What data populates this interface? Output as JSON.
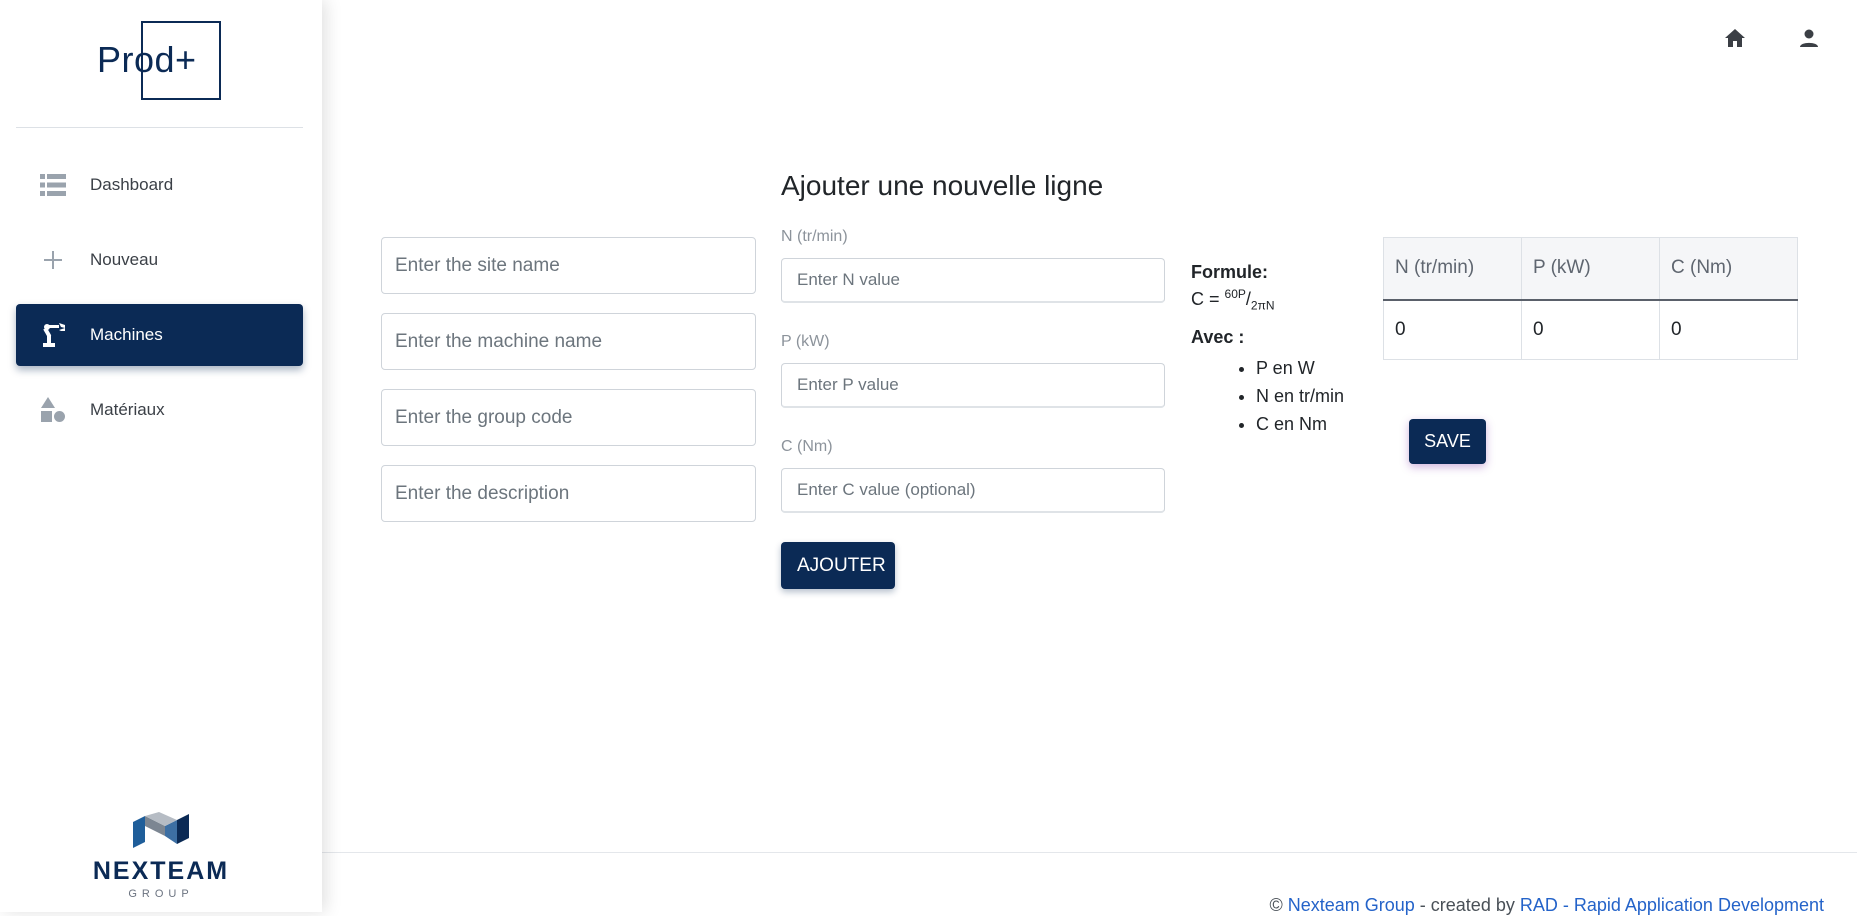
{
  "app": {
    "logo_text": "Prod+"
  },
  "sidebar": {
    "items": [
      {
        "label": "Dashboard",
        "icon": "list-icon",
        "active": false
      },
      {
        "label": "Nouveau",
        "icon": "plus-icon",
        "active": false
      },
      {
        "label": "Machines",
        "icon": "robot-arm-icon",
        "active": true
      },
      {
        "label": "Matériaux",
        "icon": "shapes-icon",
        "active": false
      }
    ],
    "brand": {
      "name": "NEXTEAM",
      "sub": "GROUP"
    }
  },
  "topbar": {
    "icons": [
      "home-icon",
      "user-icon"
    ]
  },
  "form": {
    "title": "Ajouter une nouvelle ligne",
    "site_placeholder": "Enter the site name",
    "machine_placeholder": "Enter the machine name",
    "group_placeholder": "Enter the group code",
    "description_placeholder": "Enter the description",
    "n_label": "N (tr/min)",
    "n_placeholder": "Enter N value",
    "p_label": "P (kW)",
    "p_placeholder": "Enter P value",
    "c_label": "C (Nm)",
    "c_placeholder": "Enter C value (optional)",
    "add_button": "AJOUTER"
  },
  "formula": {
    "title": "Formule:",
    "lhs": "C = ",
    "numerator": "60P",
    "slash": "/",
    "denominator": "2πN",
    "avec": "Avec :",
    "units": [
      "P en W",
      "N en tr/min",
      "C en Nm"
    ]
  },
  "table": {
    "headers": [
      "N (tr/min)",
      "P (kW)",
      "C (Nm)"
    ],
    "rows": [
      [
        "0",
        "0",
        "0"
      ]
    ]
  },
  "save_button": "SAVE",
  "footer": {
    "prefix": "© ",
    "company": "Nexteam Group",
    "middle": " - created by ",
    "creator": "RAD - Rapid Application Development"
  },
  "colors": {
    "primary": "#0b2a55",
    "link": "#2463c9"
  }
}
